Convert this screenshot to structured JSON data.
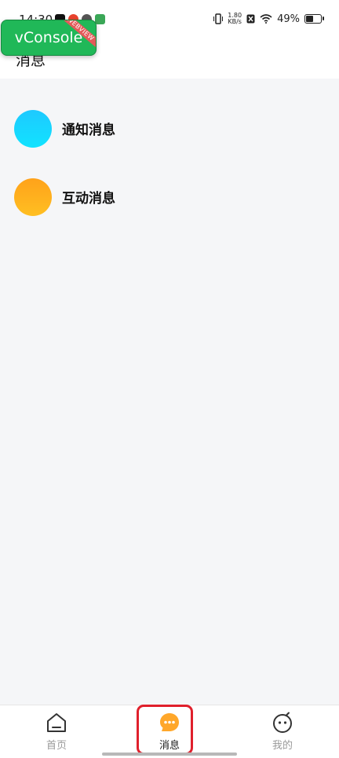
{
  "status_bar": {
    "time": "14:30",
    "net_speed_top": "1.80",
    "net_speed_bottom": "KB/s",
    "battery": "49%"
  },
  "debug": {
    "vconsole_label": "vConsole",
    "ribbon": "WEBVIEW"
  },
  "header": {
    "title": "消息"
  },
  "messages": [
    {
      "label": "通知消息",
      "color_top": "#1ec9ff",
      "color_bottom": "#11e3ff"
    },
    {
      "label": "互动消息",
      "color_top": "#ffa21a",
      "color_bottom": "#ffbf22"
    }
  ],
  "tabbar": {
    "items": [
      {
        "label": "首页",
        "icon": "home-icon"
      },
      {
        "label": "消息",
        "icon": "chat-bubble-icon",
        "active": true
      },
      {
        "label": "我的",
        "icon": "smiley-face-icon"
      }
    ],
    "active_color": "#ffa72a",
    "inactive_color": "#333333"
  }
}
